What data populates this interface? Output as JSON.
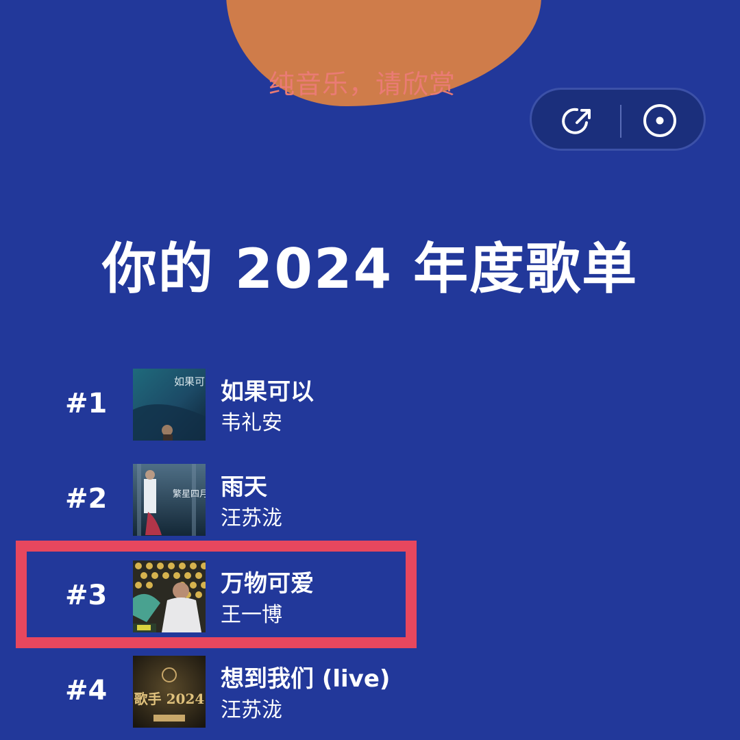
{
  "lyric": "纯音乐，请欣赏",
  "controls": {
    "share_icon": "share-arrow-icon",
    "disc_icon": "disc-icon"
  },
  "title": "你的 2024 年度歌单",
  "songs": [
    {
      "rank": "#1",
      "title": "如果可以",
      "artist": "韦礼安",
      "cover_text": "如果可以"
    },
    {
      "rank": "#2",
      "title": "雨天",
      "artist": "汪苏泷",
      "cover_text": "繁星四月"
    },
    {
      "rank": "#3",
      "title": "万物可爱",
      "artist": "王一博",
      "cover_text": "",
      "highlighted": true
    },
    {
      "rank": "#4",
      "title": "想到我们 (live)",
      "artist": "汪苏泷",
      "cover_text": "歌手 2024"
    }
  ],
  "colors": {
    "background": "#22389a",
    "blob": "#cf7c4a",
    "lyric": "#ea7b74",
    "highlight": "#e7475e",
    "text": "#ffffff"
  }
}
